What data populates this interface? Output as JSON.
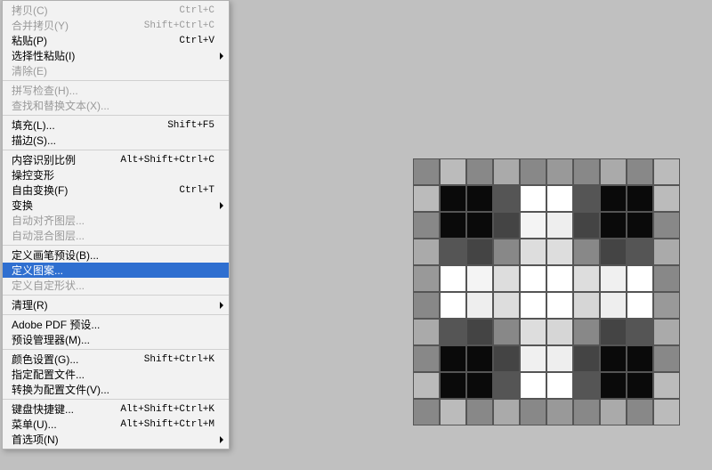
{
  "menu": {
    "groups": [
      [
        {
          "label": "拷贝(C)",
          "shortcut": "Ctrl+C",
          "disabled": true
        },
        {
          "label": "合并拷贝(Y)",
          "shortcut": "Shift+Ctrl+C",
          "disabled": true
        },
        {
          "label": "粘贴(P)",
          "shortcut": "Ctrl+V"
        },
        {
          "label": "选择性粘贴(I)",
          "submenu": true
        },
        {
          "label": "清除(E)",
          "disabled": true
        }
      ],
      [
        {
          "label": "拼写检查(H)...",
          "disabled": true
        },
        {
          "label": "查找和替换文本(X)...",
          "disabled": true
        }
      ],
      [
        {
          "label": "填充(L)...",
          "shortcut": "Shift+F5"
        },
        {
          "label": "描边(S)..."
        }
      ],
      [
        {
          "label": "内容识别比例",
          "shortcut": "Alt+Shift+Ctrl+C"
        },
        {
          "label": "操控变形"
        },
        {
          "label": "自由变换(F)",
          "shortcut": "Ctrl+T"
        },
        {
          "label": "变换",
          "submenu": true
        },
        {
          "label": "自动对齐图层...",
          "disabled": true
        },
        {
          "label": "自动混合图层...",
          "disabled": true
        }
      ],
      [
        {
          "label": "定义画笔预设(B)..."
        },
        {
          "label": "定义图案...",
          "selected": true
        },
        {
          "label": "定义自定形状...",
          "disabled": true
        }
      ],
      [
        {
          "label": "清理(R)",
          "submenu": true
        }
      ],
      [
        {
          "label": "Adobe PDF 预设..."
        },
        {
          "label": "预设管理器(M)..."
        }
      ],
      [
        {
          "label": "颜色设置(G)...",
          "shortcut": "Shift+Ctrl+K"
        },
        {
          "label": "指定配置文件..."
        },
        {
          "label": "转换为配置文件(V)..."
        }
      ],
      [
        {
          "label": "键盘快捷键...",
          "shortcut": "Alt+Shift+Ctrl+K"
        },
        {
          "label": "菜单(U)...",
          "shortcut": "Alt+Shift+Ctrl+M"
        },
        {
          "label": "首选项(N)",
          "submenu": true
        }
      ]
    ]
  },
  "pixel_art": {
    "rows": [
      [
        "#888",
        "#bbb",
        "#888",
        "#aaa",
        "#888",
        "#999",
        "#888",
        "#aaa",
        "#888",
        "#bbb"
      ],
      [
        "#bbb",
        "#0a0a0a",
        "#0a0a0a",
        "#555",
        "#fff",
        "#fff",
        "#555",
        "#0a0a0a",
        "#0a0a0a",
        "#bbb"
      ],
      [
        "#888",
        "#0a0a0a",
        "#0a0a0a",
        "#444",
        "#f4f4f4",
        "#eee",
        "#444",
        "#0a0a0a",
        "#0a0a0a",
        "#888"
      ],
      [
        "#aaa",
        "#555",
        "#444",
        "#888",
        "#ddd",
        "#ddd",
        "#888",
        "#444",
        "#555",
        "#aaa"
      ],
      [
        "#999",
        "#fff",
        "#f4f4f4",
        "#ddd",
        "#fff",
        "#fff",
        "#ddd",
        "#f0f0f0",
        "#fff",
        "#888"
      ],
      [
        "#888",
        "#fff",
        "#eee",
        "#ddd",
        "#fff",
        "#fff",
        "#d6d6d6",
        "#eee",
        "#fff",
        "#999"
      ],
      [
        "#aaa",
        "#555",
        "#444",
        "#888",
        "#ddd",
        "#d6d6d6",
        "#888",
        "#444",
        "#555",
        "#aaa"
      ],
      [
        "#888",
        "#0a0a0a",
        "#0a0a0a",
        "#444",
        "#f0f0f0",
        "#eee",
        "#444",
        "#0a0a0a",
        "#0a0a0a",
        "#888"
      ],
      [
        "#bbb",
        "#0a0a0a",
        "#0a0a0a",
        "#555",
        "#fff",
        "#fff",
        "#555",
        "#0a0a0a",
        "#0a0a0a",
        "#bbb"
      ],
      [
        "#888",
        "#bbb",
        "#888",
        "#aaa",
        "#888",
        "#999",
        "#888",
        "#aaa",
        "#888",
        "#bbb"
      ]
    ]
  }
}
